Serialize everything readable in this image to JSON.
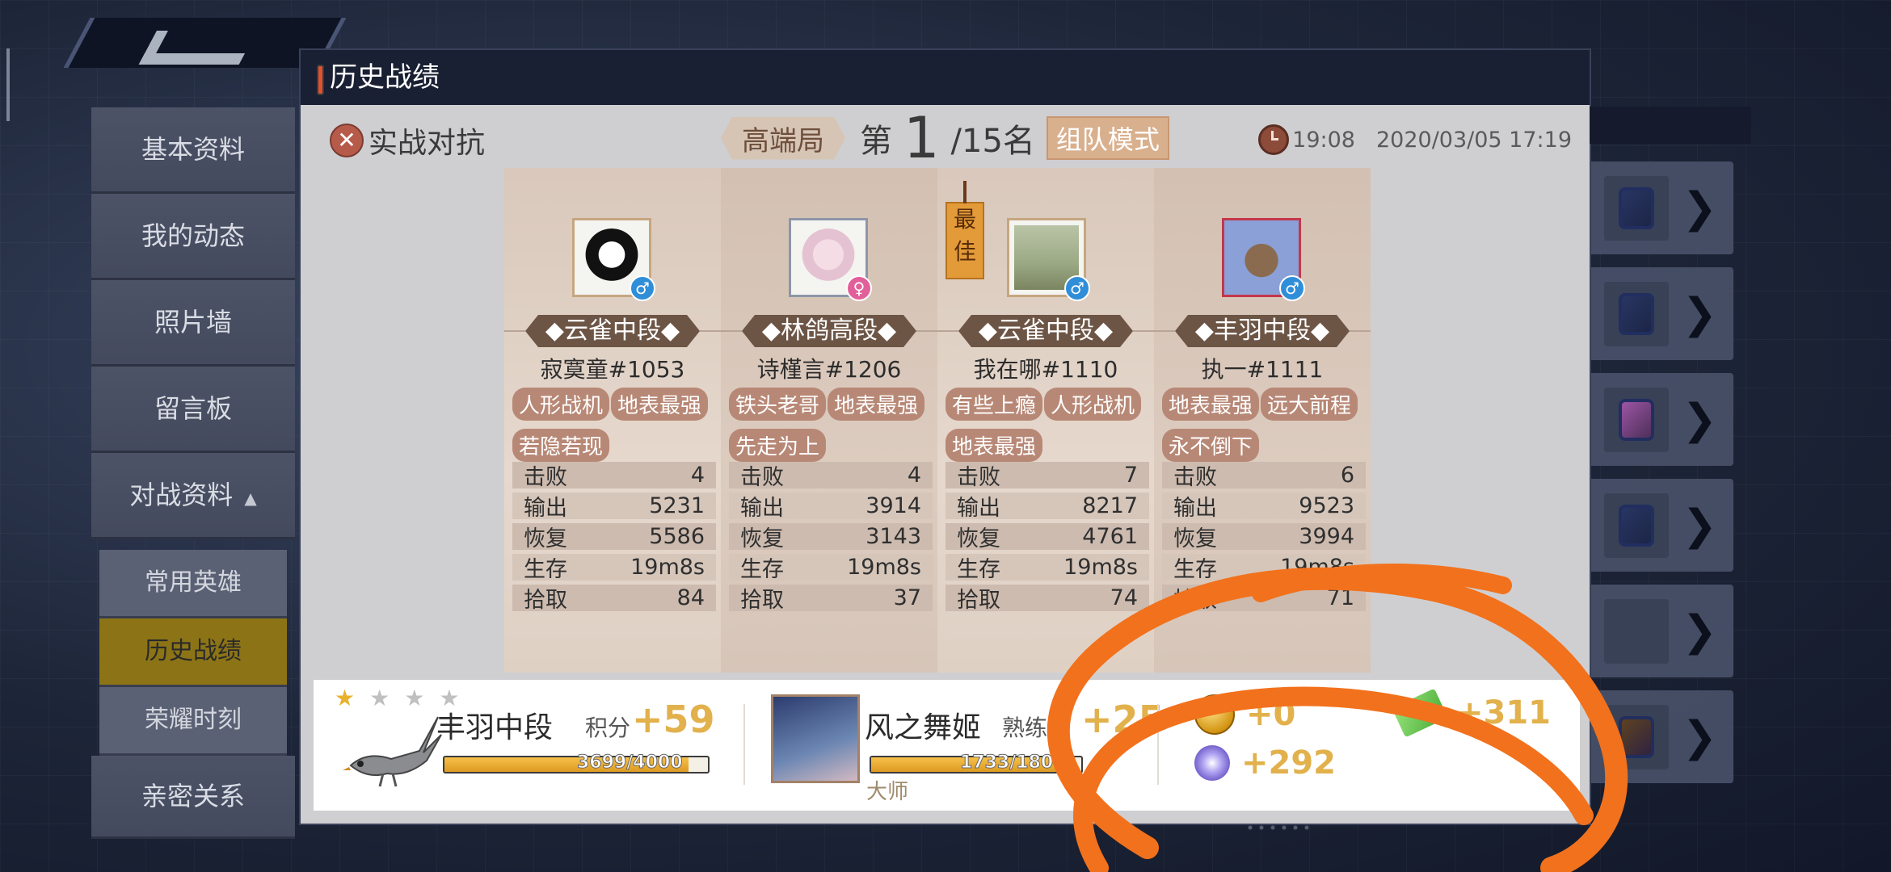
{
  "panel": {
    "title": "历史战绩"
  },
  "sidebar": {
    "items": [
      {
        "label": "基本资料"
      },
      {
        "label": "我的动态"
      },
      {
        "label": "照片墙"
      },
      {
        "label": "留言板"
      },
      {
        "label": "对战资料"
      }
    ],
    "sub_items": [
      {
        "label": "常用英雄"
      },
      {
        "label": "历史战绩"
      },
      {
        "label": "荣耀时刻"
      }
    ],
    "bottom_item": {
      "label": "亲密关系"
    },
    "active_sub": "历史战绩"
  },
  "match": {
    "mode": "实战对抗",
    "tier": "高端局",
    "rank_prefix": "第",
    "rank": "1",
    "rank_suffix": "/15名",
    "team_mode": "组队模式",
    "duration": "19:08",
    "datetime": "2020/03/05 17:19"
  },
  "players": [
    {
      "rank_badge": "◆云雀中段◆",
      "name": "寂寞童#1053",
      "gender": "♂",
      "tags": [
        "人形战机",
        "地表最强",
        "若隐若现"
      ],
      "stats": [
        {
          "label": "击败",
          "value": "4"
        },
        {
          "label": "输出",
          "value": "5231"
        },
        {
          "label": "恢复",
          "value": "5586"
        },
        {
          "label": "生存",
          "value": "19m8s"
        },
        {
          "label": "拾取",
          "value": "84"
        }
      ]
    },
    {
      "rank_badge": "◆林鸽高段◆",
      "name": "诗槿言#1206",
      "gender": "♀",
      "tags": [
        "铁头老哥",
        "地表最强",
        "先走为上"
      ],
      "stats": [
        {
          "label": "击败",
          "value": "4"
        },
        {
          "label": "输出",
          "value": "3914"
        },
        {
          "label": "恢复",
          "value": "3143"
        },
        {
          "label": "生存",
          "value": "19m8s"
        },
        {
          "label": "拾取",
          "value": "37"
        }
      ]
    },
    {
      "rank_badge": "◆云雀中段◆",
      "name": "我在哪#1110",
      "gender": "♂",
      "best_label": "最佳",
      "tags": [
        "有些上瘾",
        "人形战机",
        "地表最强"
      ],
      "stats": [
        {
          "label": "击败",
          "value": "7"
        },
        {
          "label": "输出",
          "value": "8217"
        },
        {
          "label": "恢复",
          "value": "4761"
        },
        {
          "label": "生存",
          "value": "19m8s"
        },
        {
          "label": "拾取",
          "value": "74"
        }
      ]
    },
    {
      "rank_badge": "◆丰羽中段◆",
      "name": "执一#1111",
      "gender": "♂",
      "tags": [
        "地表最强",
        "远大前程",
        "永不倒下"
      ],
      "stats": [
        {
          "label": "击败",
          "value": "6"
        },
        {
          "label": "输出",
          "value": "9523"
        },
        {
          "label": "恢复",
          "value": "3994"
        },
        {
          "label": "生存",
          "value": "19m8s"
        },
        {
          "label": "拾取",
          "value": "71"
        }
      ]
    }
  ],
  "summary": {
    "rank_title": "丰羽中段",
    "score_label": "积分",
    "score_gain": "+59",
    "score_progress": "3699/4000",
    "score_fraction": 0.925,
    "hero_name": "风之舞姬",
    "proficiency_label": "熟练度",
    "proficiency_gain": "+25",
    "proficiency_progress": "1733/180",
    "proficiency_fraction": 0.92,
    "hero_level": "大师",
    "rewards": {
      "coins": "+0",
      "tickets": "+311",
      "crystals": "+292"
    }
  },
  "colors": {
    "accent": "#e2512d",
    "gold_text": "#e2b14c",
    "annotation_orange": "#f2711c",
    "active_sidebar": "#8c7416"
  },
  "icons": [
    "close-x-icon",
    "clock-icon",
    "male-icon",
    "female-icon",
    "coin-icon",
    "ticket-icon",
    "crystal-icon",
    "arrow-right-icon",
    "caret-up-icon"
  ]
}
